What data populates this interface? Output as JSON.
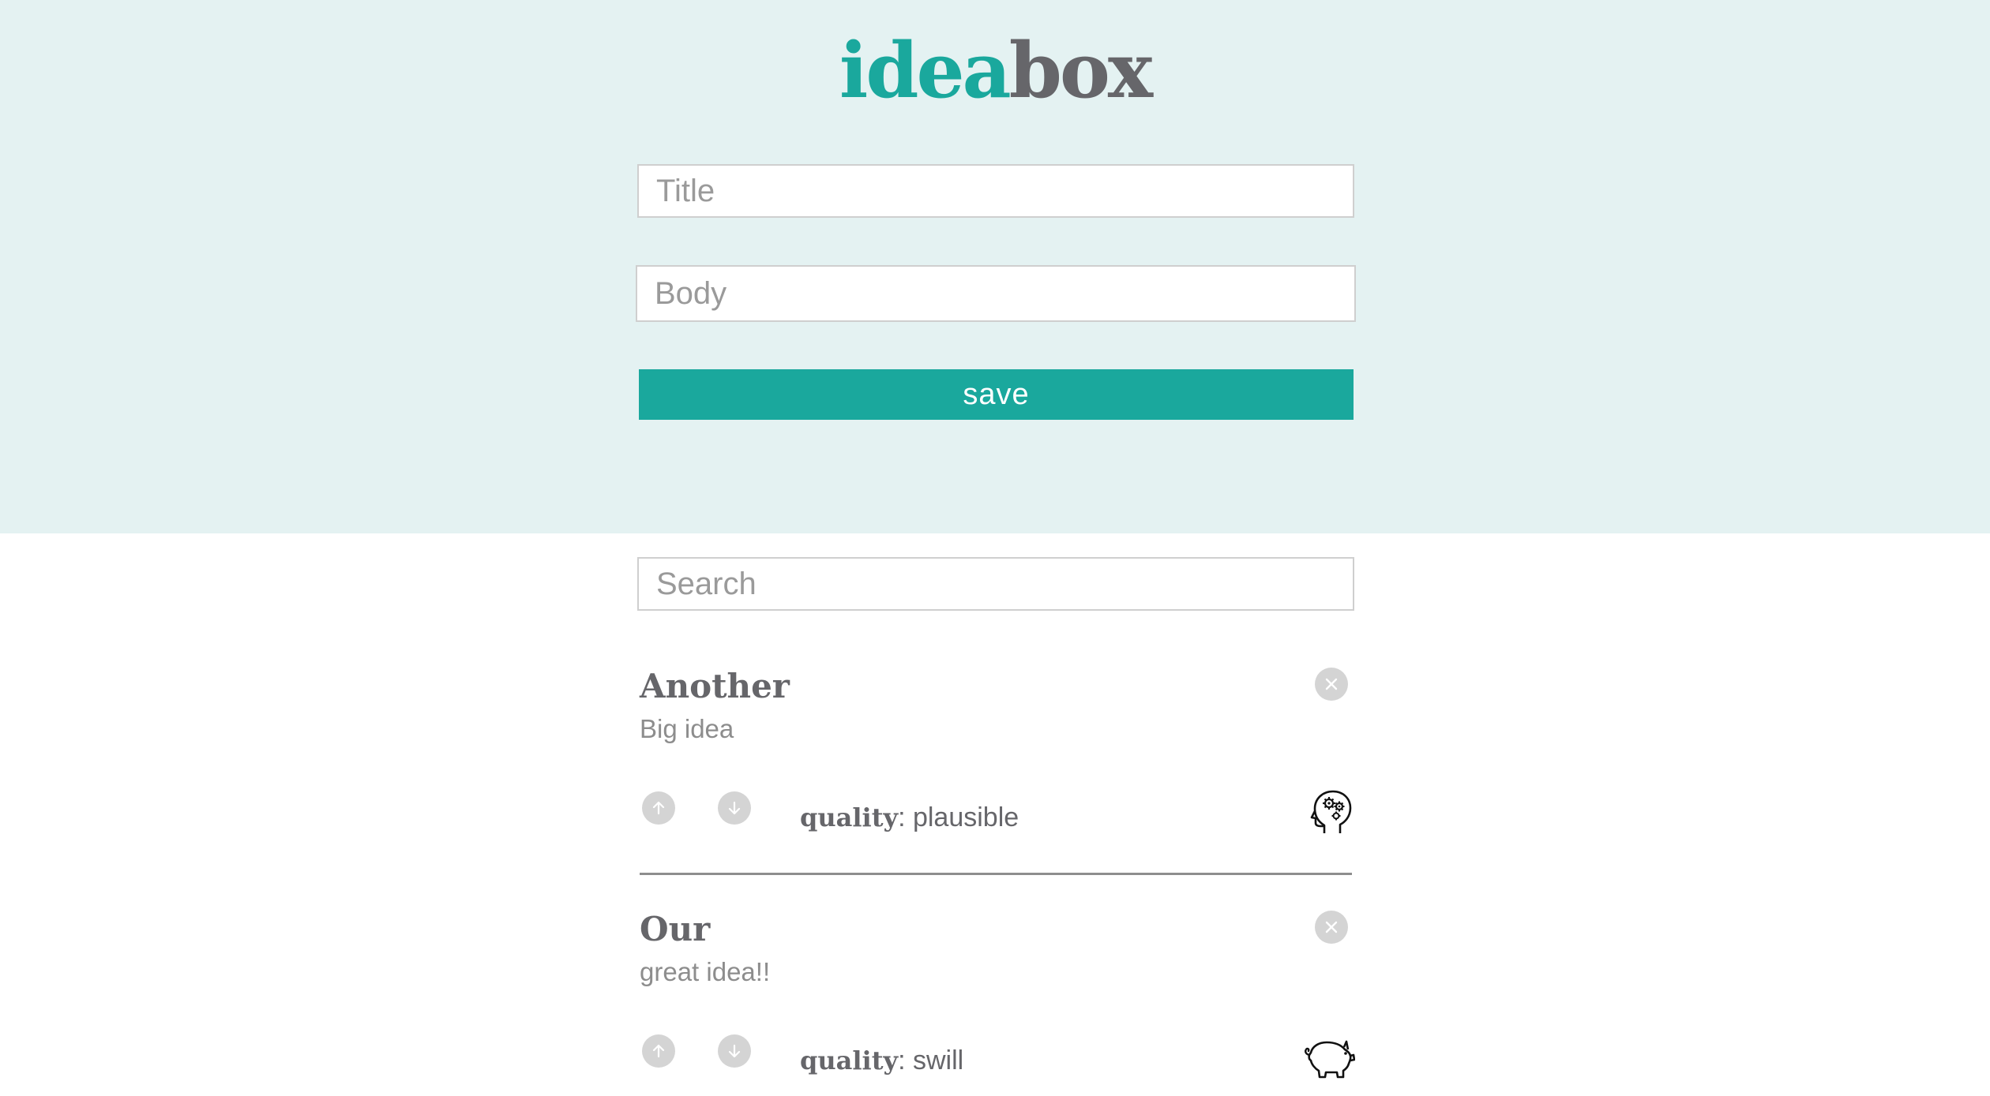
{
  "header": {
    "logo_part1": "idea",
    "logo_part2": "box",
    "title_placeholder": "Title",
    "body_placeholder": "Body",
    "save_label": "save",
    "background_color": "#e4f2f2",
    "accent_color": "#1aa89d"
  },
  "search": {
    "placeholder": "Search"
  },
  "ideas": [
    {
      "title": "Another",
      "body": "Big idea",
      "quality_label": "quality",
      "quality_value": "plausible",
      "quality_icon": "thinking-head-gears-icon"
    },
    {
      "title": "Our",
      "body": "great idea!!",
      "quality_label": "quality",
      "quality_value": "swill",
      "quality_icon": "pig-icon"
    }
  ]
}
